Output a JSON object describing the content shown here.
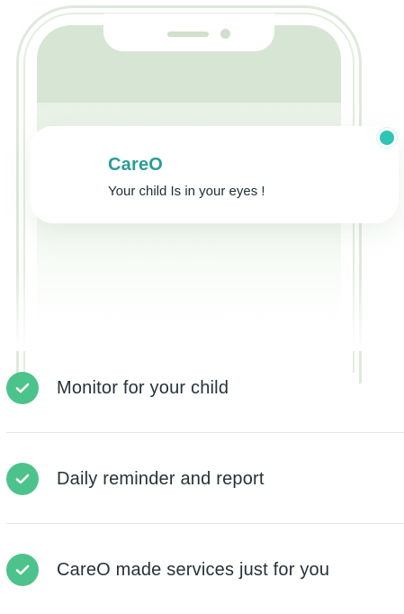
{
  "notification": {
    "app_name": "CareO",
    "message": "Your child Is in your eyes !"
  },
  "features": [
    {
      "label": "Monitor for your child",
      "icon": "check-icon"
    },
    {
      "label": "Daily reminder and report",
      "icon": "check-icon"
    },
    {
      "label": "CareO made services just for you",
      "icon": "check-icon"
    }
  ],
  "colors": {
    "accent_teal": "#2a9d95",
    "status_dot": "#2ec4b6",
    "check_green": "#4cc38a",
    "phone_screen": "#d7e6d4"
  }
}
